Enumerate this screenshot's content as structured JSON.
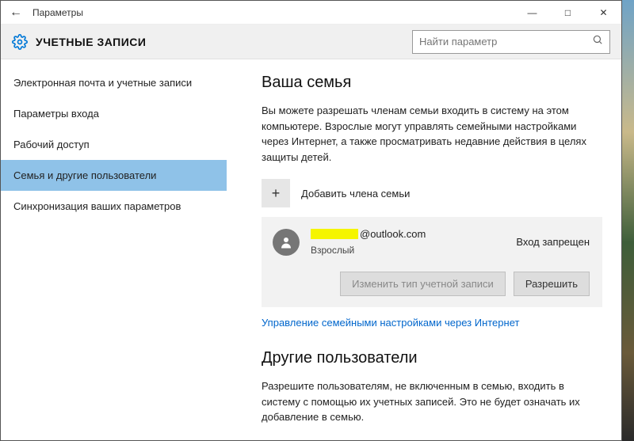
{
  "titlebar": {
    "title": "Параметры"
  },
  "header": {
    "heading": "УЧЕТНЫЕ ЗАПИСИ",
    "search_placeholder": "Найти параметр"
  },
  "sidebar": {
    "items": [
      {
        "label": "Электронная почта и учетные записи"
      },
      {
        "label": "Параметры входа"
      },
      {
        "label": "Рабочий доступ"
      },
      {
        "label": "Семья и другие пользователи"
      },
      {
        "label": "Синхронизация ваших параметров"
      }
    ],
    "active_index": 3
  },
  "family": {
    "heading": "Ваша семья",
    "description": "Вы можете разрешать членам семьи входить в систему на этом компьютере. Взрослые могут управлять семейными настройками через Интернет, а также просматривать недавние действия в целях защиты детей.",
    "add_label": "Добавить члена семьи",
    "member": {
      "email_suffix": "@outlook.com",
      "role": "Взрослый",
      "status": "Вход запрещен",
      "change_type_label": "Изменить тип учетной записи",
      "allow_label": "Разрешить"
    },
    "manage_link": "Управление семейными настройками через Интернет"
  },
  "others": {
    "heading": "Другие пользователи",
    "description": "Разрешите пользователям, не включенным в семью, входить в систему с помощью их учетных записей. Это не будет означать их добавление в семью."
  }
}
